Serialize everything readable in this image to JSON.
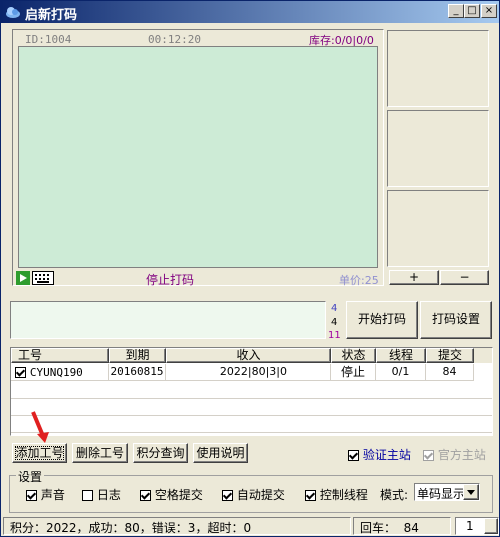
{
  "window": {
    "title": "启新打码",
    "min": "_",
    "max": "□",
    "close": "×"
  },
  "captcha": {
    "id_text": "ID:1004",
    "timer": "00:12:20",
    "stock": "库存:0/0|0/0",
    "status": "停止打码",
    "price": "单价:25"
  },
  "side": {
    "plus": "+",
    "minus": "−"
  },
  "counters": [
    "4",
    "4",
    "11"
  ],
  "buttons": {
    "start": "开始打码",
    "settings": "打码设置"
  },
  "table": {
    "headers": [
      "工号",
      "到期",
      "收入",
      "状态",
      "线程",
      "提交"
    ],
    "rows": [
      {
        "account": "CYUNQ190",
        "expire": "20160815",
        "income": "2022|80|3|0",
        "status": "停止",
        "threads": "0/1",
        "submit": "84"
      }
    ]
  },
  "actions": {
    "add": "添加工号",
    "delete": "删除工号",
    "points": "积分查询",
    "help": "使用说明",
    "verify": "验证主站",
    "official": "官方主站"
  },
  "settings": {
    "legend": "设置",
    "sound": "声音",
    "log": "日志",
    "space": "空格提交",
    "auto": "自动提交",
    "control": "控制线程",
    "mode_label": "模式:",
    "mode_value": "单码显示"
  },
  "statusbar": {
    "summary": "积分：2022，成功：80，错误：3，超时：0",
    "enter": "回车：  84",
    "page": "1"
  },
  "colors": {
    "screen": "#cdebd6",
    "purple": "#800080",
    "accent": "#0a246a"
  }
}
